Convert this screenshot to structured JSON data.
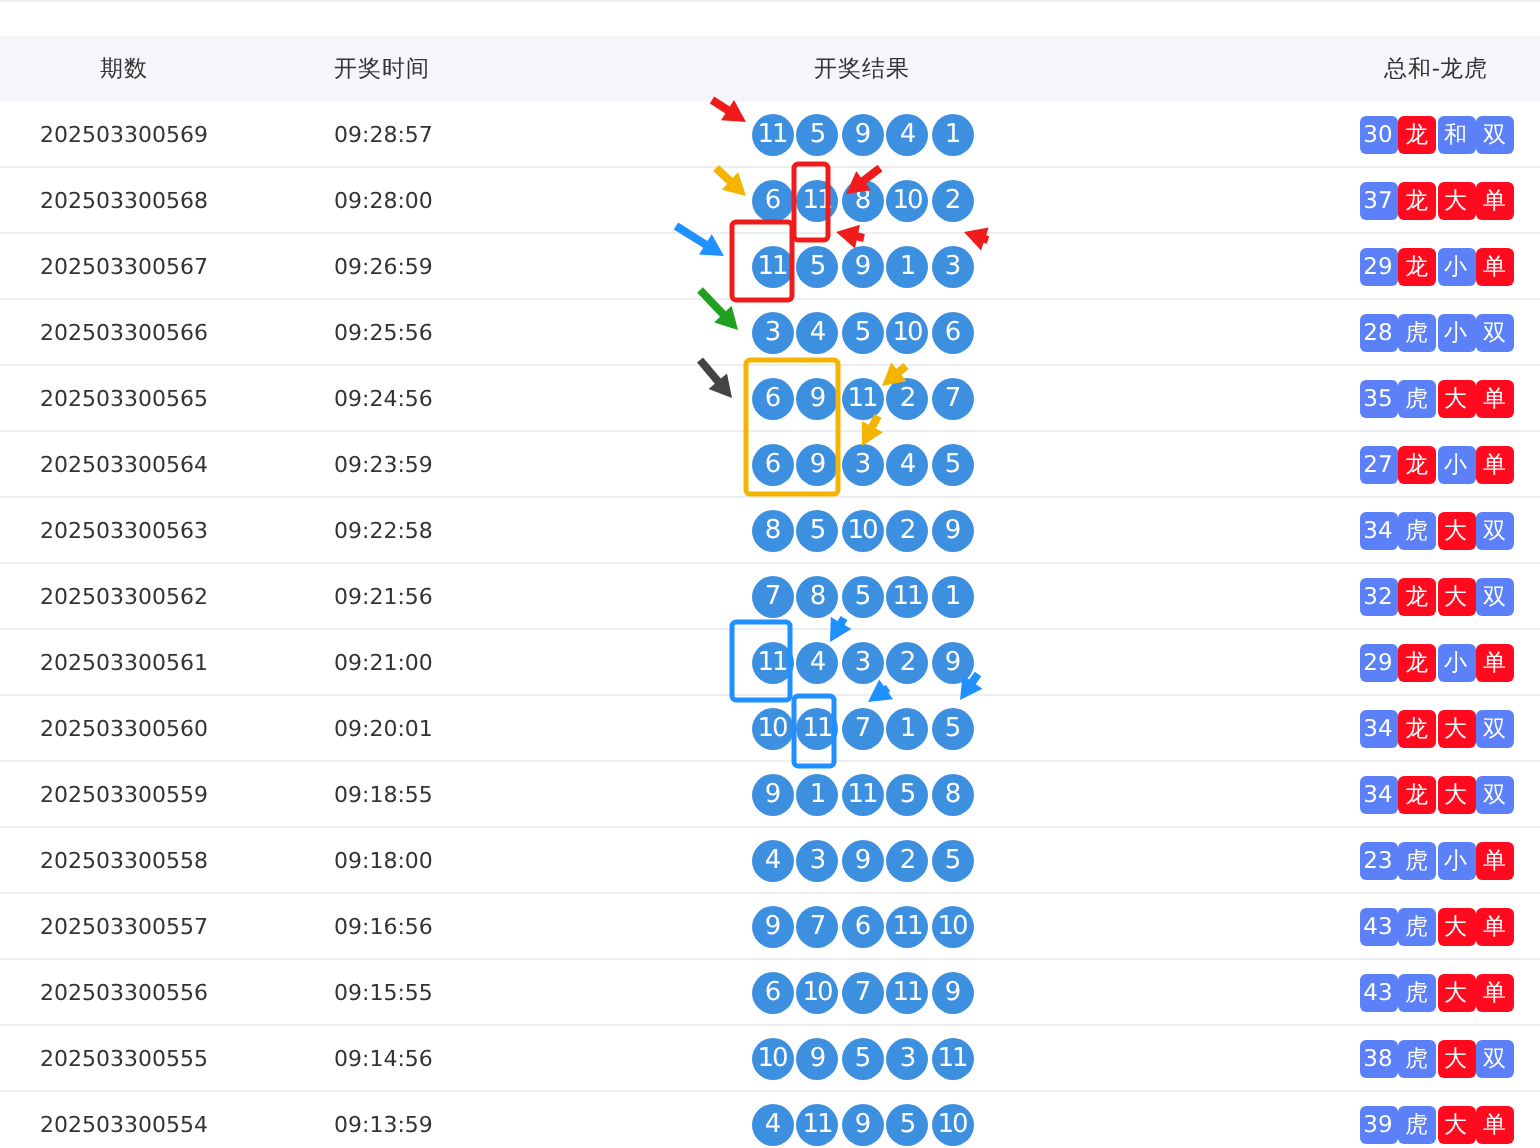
{
  "columns": [
    "期数",
    "开奖时间",
    "开奖结果",
    "总和-龙虎"
  ],
  "rows": [
    {
      "period": "202503300569",
      "time": "09:28:57",
      "balls": [
        "11",
        "5",
        "9",
        "4",
        "1"
      ],
      "sum": "30",
      "tags": [
        {
          "text": "龙",
          "color": "#ff0a1e"
        },
        {
          "text": "和",
          "color": "#5b80f7"
        },
        {
          "text": "双",
          "color": "#5b80f7"
        }
      ]
    },
    {
      "period": "202503300568",
      "time": "09:28:00",
      "balls": [
        "6",
        "11",
        "8",
        "10",
        "2"
      ],
      "sum": "37",
      "tags": [
        {
          "text": "龙",
          "color": "#ff0a1e"
        },
        {
          "text": "大",
          "color": "#ff0a1e"
        },
        {
          "text": "单",
          "color": "#ff0a1e"
        }
      ]
    },
    {
      "period": "202503300567",
      "time": "09:26:59",
      "balls": [
        "11",
        "5",
        "9",
        "1",
        "3"
      ],
      "sum": "29",
      "tags": [
        {
          "text": "龙",
          "color": "#ff0a1e"
        },
        {
          "text": "小",
          "color": "#5b80f7"
        },
        {
          "text": "单",
          "color": "#ff0a1e"
        }
      ]
    },
    {
      "period": "202503300566",
      "time": "09:25:56",
      "balls": [
        "3",
        "4",
        "5",
        "10",
        "6"
      ],
      "sum": "28",
      "tags": [
        {
          "text": "虎",
          "color": "#5b80f7"
        },
        {
          "text": "小",
          "color": "#5b80f7"
        },
        {
          "text": "双",
          "color": "#5b80f7"
        }
      ]
    },
    {
      "period": "202503300565",
      "time": "09:24:56",
      "balls": [
        "6",
        "9",
        "11",
        "2",
        "7"
      ],
      "sum": "35",
      "tags": [
        {
          "text": "虎",
          "color": "#5b80f7"
        },
        {
          "text": "大",
          "color": "#ff0a1e"
        },
        {
          "text": "单",
          "color": "#ff0a1e"
        }
      ]
    },
    {
      "period": "202503300564",
      "time": "09:23:59",
      "balls": [
        "6",
        "9",
        "3",
        "4",
        "5"
      ],
      "sum": "27",
      "tags": [
        {
          "text": "龙",
          "color": "#ff0a1e"
        },
        {
          "text": "小",
          "color": "#5b80f7"
        },
        {
          "text": "单",
          "color": "#ff0a1e"
        }
      ]
    },
    {
      "period": "202503300563",
      "time": "09:22:58",
      "balls": [
        "8",
        "5",
        "10",
        "2",
        "9"
      ],
      "sum": "34",
      "tags": [
        {
          "text": "虎",
          "color": "#5b80f7"
        },
        {
          "text": "大",
          "color": "#ff0a1e"
        },
        {
          "text": "双",
          "color": "#5b80f7"
        }
      ]
    },
    {
      "period": "202503300562",
      "time": "09:21:56",
      "balls": [
        "7",
        "8",
        "5",
        "11",
        "1"
      ],
      "sum": "32",
      "tags": [
        {
          "text": "龙",
          "color": "#ff0a1e"
        },
        {
          "text": "大",
          "color": "#ff0a1e"
        },
        {
          "text": "双",
          "color": "#5b80f7"
        }
      ]
    },
    {
      "period": "202503300561",
      "time": "09:21:00",
      "balls": [
        "11",
        "4",
        "3",
        "2",
        "9"
      ],
      "sum": "29",
      "tags": [
        {
          "text": "龙",
          "color": "#ff0a1e"
        },
        {
          "text": "小",
          "color": "#5b80f7"
        },
        {
          "text": "单",
          "color": "#ff0a1e"
        }
      ]
    },
    {
      "period": "202503300560",
      "time": "09:20:01",
      "balls": [
        "10",
        "11",
        "7",
        "1",
        "5"
      ],
      "sum": "34",
      "tags": [
        {
          "text": "龙",
          "color": "#ff0a1e"
        },
        {
          "text": "大",
          "color": "#ff0a1e"
        },
        {
          "text": "双",
          "color": "#5b80f7"
        }
      ]
    },
    {
      "period": "202503300559",
      "time": "09:18:55",
      "balls": [
        "9",
        "1",
        "11",
        "5",
        "8"
      ],
      "sum": "34",
      "tags": [
        {
          "text": "龙",
          "color": "#ff0a1e"
        },
        {
          "text": "大",
          "color": "#ff0a1e"
        },
        {
          "text": "双",
          "color": "#5b80f7"
        }
      ]
    },
    {
      "period": "202503300558",
      "time": "09:18:00",
      "balls": [
        "4",
        "3",
        "9",
        "2",
        "5"
      ],
      "sum": "23",
      "tags": [
        {
          "text": "虎",
          "color": "#5b80f7"
        },
        {
          "text": "小",
          "color": "#5b80f7"
        },
        {
          "text": "单",
          "color": "#ff0a1e"
        }
      ]
    },
    {
      "period": "202503300557",
      "time": "09:16:56",
      "balls": [
        "9",
        "7",
        "6",
        "11",
        "10"
      ],
      "sum": "43",
      "tags": [
        {
          "text": "虎",
          "color": "#5b80f7"
        },
        {
          "text": "大",
          "color": "#ff0a1e"
        },
        {
          "text": "单",
          "color": "#ff0a1e"
        }
      ]
    },
    {
      "period": "202503300556",
      "time": "09:15:55",
      "balls": [
        "6",
        "10",
        "7",
        "11",
        "9"
      ],
      "sum": "43",
      "tags": [
        {
          "text": "虎",
          "color": "#5b80f7"
        },
        {
          "text": "大",
          "color": "#ff0a1e"
        },
        {
          "text": "单",
          "color": "#ff0a1e"
        }
      ]
    },
    {
      "period": "202503300555",
      "time": "09:14:56",
      "balls": [
        "10",
        "9",
        "5",
        "3",
        "11"
      ],
      "sum": "38",
      "tags": [
        {
          "text": "虎",
          "color": "#5b80f7"
        },
        {
          "text": "大",
          "color": "#ff0a1e"
        },
        {
          "text": "双",
          "color": "#5b80f7"
        }
      ]
    },
    {
      "period": "202503300554",
      "time": "09:13:59",
      "balls": [
        "4",
        "11",
        "9",
        "5",
        "10"
      ],
      "sum": "39",
      "tags": [
        {
          "text": "虎",
          "color": "#5b80f7"
        },
        {
          "text": "大",
          "color": "#ff0a1e"
        },
        {
          "text": "单",
          "color": "#ff0a1e"
        }
      ]
    }
  ]
}
